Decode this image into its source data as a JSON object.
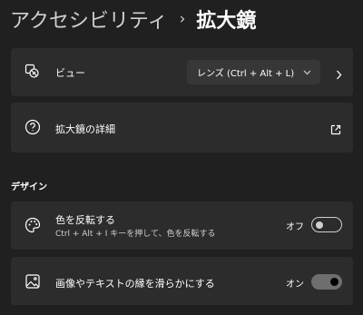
{
  "breadcrumb": {
    "parent": "アクセシビリティ",
    "separator": "›",
    "current": "拡大鏡"
  },
  "view_row": {
    "label": "ビュー",
    "icon": "magnifier-view-icon",
    "dropdown_value": "レンズ (Ctrl + Alt + L)"
  },
  "details_row": {
    "label": "拡大鏡の詳細",
    "icon": "help-circle-icon"
  },
  "design_section": {
    "title": "デザイン"
  },
  "invert_row": {
    "label": "色を反転する",
    "description": "Ctrl + Alt + I キーを押して、色を反転する",
    "icon": "palette-icon",
    "state_text": "オフ",
    "checked": false
  },
  "smooth_row": {
    "label": "画像やテキストの縁を滑らかにする",
    "icon": "image-icon",
    "state_text": "オン",
    "checked": true
  },
  "colors": {
    "background": "#202020",
    "card": "#2c2c2c",
    "dropdown": "#373737",
    "toggle_on": "#6e6e6e"
  }
}
